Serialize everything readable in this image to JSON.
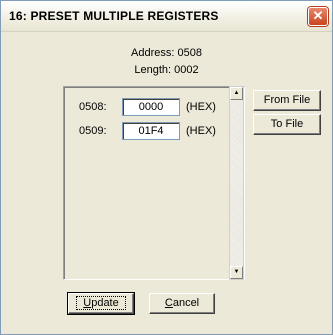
{
  "window": {
    "title": "16: PRESET MULTIPLE REGISTERS"
  },
  "info": {
    "address": "Address: 0508",
    "length": "Length: 0002"
  },
  "registers": [
    {
      "address": "0508:",
      "value": "0000",
      "format": "(HEX)"
    },
    {
      "address": "0509:",
      "value": "01F4",
      "format": "(HEX)"
    }
  ],
  "buttons": {
    "from_file": "From File",
    "to_file": "To File",
    "update_rest": "pdate",
    "update_mnemonic": "U",
    "cancel_rest": "ancel",
    "cancel_mnemonic": "C"
  },
  "icons": {
    "close": "close-x-icon",
    "scroll_up": "scroll-up-arrow-icon",
    "scroll_down": "scroll-down-arrow-icon"
  }
}
